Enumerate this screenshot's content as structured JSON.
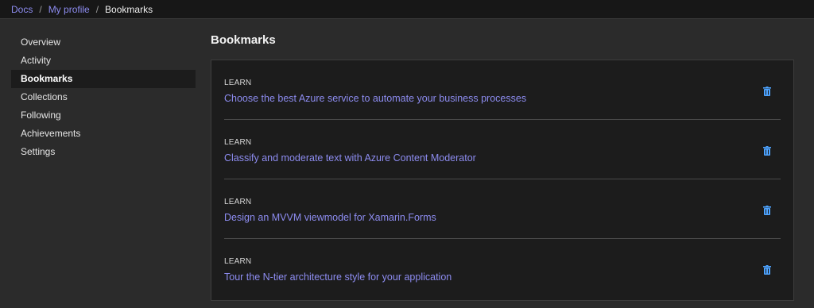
{
  "breadcrumb": {
    "items": [
      "Docs",
      "My profile"
    ],
    "separator": "/",
    "current": "Bookmarks"
  },
  "sidebar": {
    "items": [
      {
        "label": "Overview",
        "active": false
      },
      {
        "label": "Activity",
        "active": false
      },
      {
        "label": "Bookmarks",
        "active": true
      },
      {
        "label": "Collections",
        "active": false
      },
      {
        "label": "Following",
        "active": false
      },
      {
        "label": "Achievements",
        "active": false
      },
      {
        "label": "Settings",
        "active": false
      }
    ]
  },
  "main": {
    "title": "Bookmarks",
    "bookmarks": [
      {
        "category": "LEARN",
        "title": "Choose the best Azure service to automate your business processes",
        "delete_icon": "trash-icon"
      },
      {
        "category": "LEARN",
        "title": "Classify and moderate text with Azure Content Moderator",
        "delete_icon": "trash-icon"
      },
      {
        "category": "LEARN",
        "title": "Design an MVVM viewmodel for Xamarin.Forms",
        "delete_icon": "trash-icon"
      },
      {
        "category": "LEARN",
        "title": "Tour the N-tier architecture style for your application",
        "delete_icon": "trash-icon"
      }
    ]
  },
  "colors": {
    "link": "#8d8cf0",
    "icon_accent": "#4da3ff",
    "background": "#2b2b2b",
    "card_background": "#1c1c1c"
  }
}
